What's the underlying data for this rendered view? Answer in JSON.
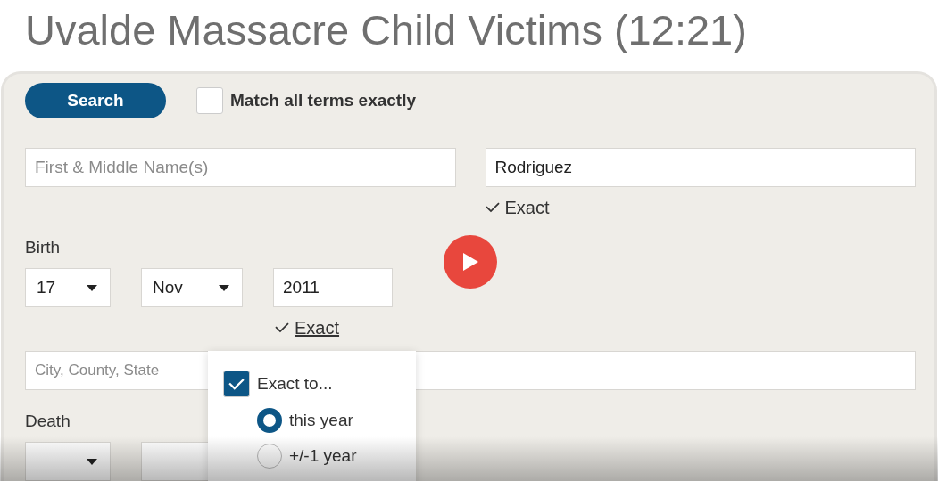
{
  "video": {
    "title": "Uvalde Massacre Child Victims (12:21)"
  },
  "form": {
    "search_button": "Search",
    "match_all": {
      "label": "Match all terms exactly",
      "checked": false
    },
    "first_name": {
      "placeholder": "First & Middle Name(s)"
    },
    "last_name": {
      "value": "Rodriguez",
      "exact": {
        "label": "Exact",
        "checked": true
      }
    },
    "birth": {
      "label": "Birth",
      "day": "17",
      "month": "Nov",
      "year": "2011",
      "exact": {
        "label": "Exact",
        "checked": true
      },
      "place": {
        "placeholder": "City, County, State"
      }
    },
    "death": {
      "label": "Death"
    },
    "exact_popover": {
      "checkbox": {
        "label": "Exact to...",
        "checked": true
      },
      "options": [
        {
          "label": "this year",
          "selected": true
        },
        {
          "label": "+/-1 year",
          "selected": false
        }
      ]
    }
  }
}
